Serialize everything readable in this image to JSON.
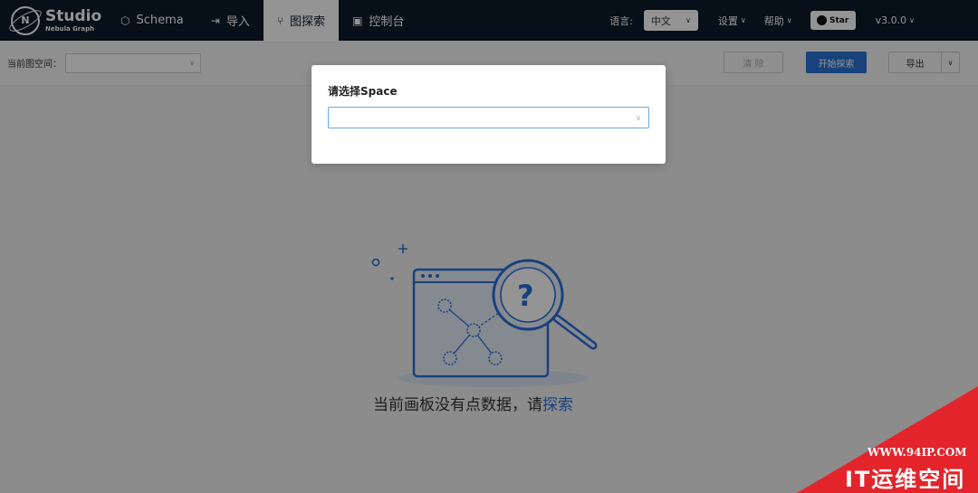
{
  "header": {
    "logo": {
      "title": "Studio",
      "subtitle": "Nebula Graph",
      "mark": "N"
    },
    "nav": [
      {
        "label": "Schema",
        "icon": "schema-icon",
        "active": false
      },
      {
        "label": "导入",
        "icon": "import-icon",
        "active": false
      },
      {
        "label": "图探索",
        "icon": "explore-icon",
        "active": true
      },
      {
        "label": "控制台",
        "icon": "console-icon",
        "active": false
      }
    ],
    "language_label": "语言:",
    "language_value": "中文",
    "settings_label": "设置",
    "help_label": "帮助",
    "star_label": "Star",
    "version_label": "v3.0.0"
  },
  "toolbar": {
    "space_label": "当前图空间：",
    "space_value": "",
    "clear_label": "清 除",
    "start_label": "开始探索",
    "export_label": "导出"
  },
  "canvas": {
    "empty_text": "当前画板没有点数据，请",
    "empty_link": "探索"
  },
  "modal": {
    "title": "请选择Space",
    "select_value": ""
  },
  "watermark": {
    "url": "WWW.94IP.COM",
    "text": "IT运维空间"
  },
  "colors": {
    "header_bg": "#0d1b2a",
    "primary": "#2b73d6",
    "watermark": "#e3242b"
  }
}
